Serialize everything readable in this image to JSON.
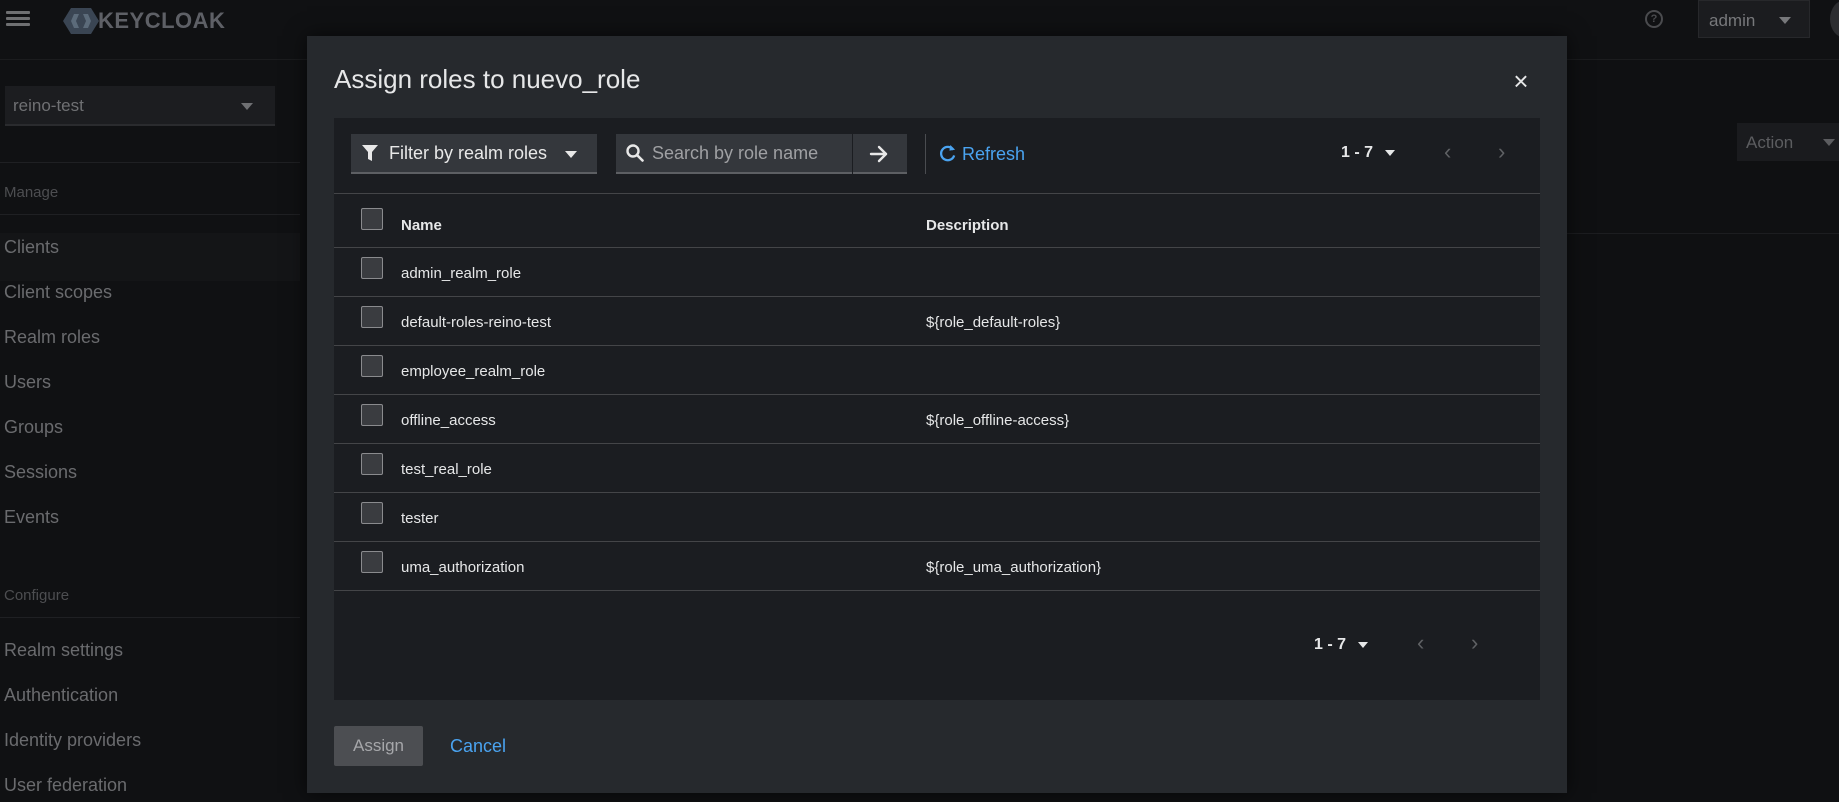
{
  "app": {
    "logo_text": "KEYCLOAK",
    "user_menu": "admin",
    "realm_selector": "reino-test",
    "page_action": "Action"
  },
  "sidebar": {
    "manage_heading": "Manage",
    "manage_items": [
      "Clients",
      "Client scopes",
      "Realm roles",
      "Users",
      "Groups",
      "Sessions",
      "Events"
    ],
    "configure_heading": "Configure",
    "configure_items": [
      "Realm settings",
      "Authentication",
      "Identity providers",
      "User federation"
    ]
  },
  "modal": {
    "title": "Assign roles to nuevo_role",
    "close_label": "×",
    "filter_label": "Filter by realm roles",
    "search_placeholder": "Search by role name",
    "refresh_label": "Refresh",
    "pager_top": "1 - 7",
    "pager_bottom": "1 - 7",
    "columns": {
      "name": "Name",
      "description": "Description"
    },
    "rows": [
      {
        "name": "admin_realm_role",
        "description": ""
      },
      {
        "name": "default-roles-reino-test",
        "description": "${role_default-roles}"
      },
      {
        "name": "employee_realm_role",
        "description": ""
      },
      {
        "name": "offline_access",
        "description": "${role_offline-access}"
      },
      {
        "name": "test_real_role",
        "description": ""
      },
      {
        "name": "tester",
        "description": ""
      },
      {
        "name": "uma_authorization",
        "description": "${role_uma_authorization}"
      }
    ],
    "assign_label": "Assign",
    "cancel_label": "Cancel"
  },
  "colors": {
    "accent_link": "#4aa3f0",
    "modal_bg": "#26292d",
    "table_bg": "#1b1d21"
  },
  "icons": [
    "menu-icon",
    "keycloak-logo-icon",
    "help-icon",
    "filter-icon",
    "search-icon",
    "arrow-right-icon",
    "refresh-icon",
    "chevron-left-icon",
    "chevron-right-icon",
    "close-icon"
  ]
}
